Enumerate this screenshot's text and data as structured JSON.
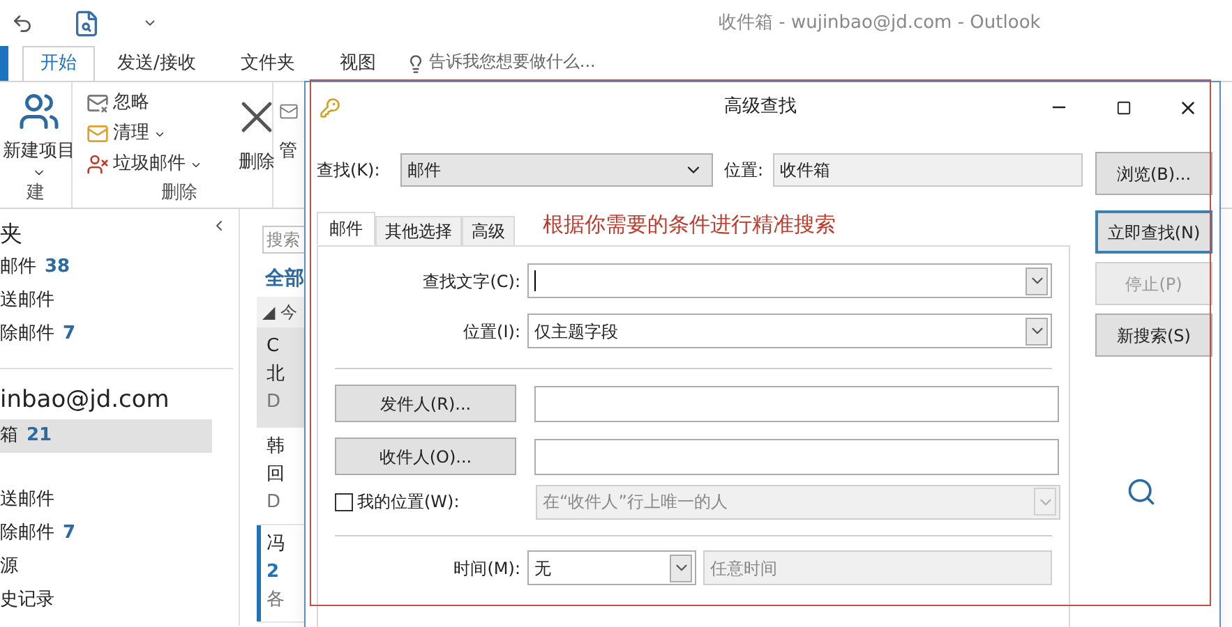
{
  "app": {
    "title": "收件箱 - wujinbao@jd.com - Outlook"
  },
  "ribbon": {
    "tabs": [
      {
        "label": "开始",
        "selected": true
      },
      {
        "label": "发送/接收",
        "selected": false
      },
      {
        "label": "文件夹",
        "selected": false
      },
      {
        "label": "视图",
        "selected": false
      }
    ],
    "tell_me": "告诉我您想要做什么...",
    "groups": [
      {
        "label": "建",
        "buttons": [
          {
            "kind": "large",
            "label": "新建项目",
            "dropdown": true
          }
        ]
      },
      {
        "label": "删除",
        "buttons": [
          {
            "kind": "small",
            "label": "忽略",
            "dropdown": false
          },
          {
            "kind": "small",
            "label": "清理",
            "dropdown": true
          },
          {
            "kind": "small",
            "label": "垃圾邮件",
            "dropdown": true
          },
          {
            "kind": "large",
            "label": "删除",
            "dropdown": false
          }
        ]
      },
      {
        "buttons": [
          {
            "kind": "large",
            "label": "管",
            "dropdown": false
          }
        ]
      }
    ]
  },
  "folder_pane": {
    "header": "夹",
    "favorites": [
      {
        "name": "邮件",
        "count": "38"
      },
      {
        "name": "送邮件"
      },
      {
        "name": "除邮件",
        "count": "7"
      }
    ],
    "account": "inbao@jd.com",
    "folders": [
      {
        "name": "箱",
        "count": "21",
        "selected": true
      },
      {
        "name": "送邮件",
        "selected": false
      },
      {
        "name": "除邮件",
        "count": "7",
        "selected": false
      },
      {
        "name": "源",
        "selected": false
      },
      {
        "name": "史记录",
        "selected": false
      }
    ]
  },
  "message_list": {
    "search_placeholder": "搜索",
    "filter": "全部",
    "group": "◢ 今",
    "messages": [
      {
        "lines": [
          "C",
          "北",
          "D"
        ],
        "selected": true,
        "unread": false
      },
      {
        "lines": [
          "韩",
          "回",
          "D"
        ],
        "selected": false,
        "unread": false
      },
      {
        "lines": [
          "冯",
          "2",
          "各"
        ],
        "selected": false,
        "unread": true
      }
    ]
  },
  "dialog": {
    "title": "高级查找",
    "look_for": {
      "label": "查找(K):",
      "value": "邮件"
    },
    "in": {
      "label": "位置:",
      "value": "收件箱"
    },
    "browse": "浏览(B)...",
    "tabs": [
      {
        "label": "邮件",
        "selected": true
      },
      {
        "label": "其他选择",
        "selected": false
      },
      {
        "label": "高级",
        "selected": false
      }
    ],
    "actions": [
      {
        "label": "立即查找(N)",
        "default": true,
        "disabled": false
      },
      {
        "label": "停止(P)",
        "default": false,
        "disabled": true
      },
      {
        "label": "新搜索(S)",
        "default": false,
        "disabled": false
      }
    ],
    "search_text": {
      "label": "查找文字(C):",
      "focused": true
    },
    "in_field": {
      "label": "位置(I):",
      "value": "仅主题字段"
    },
    "from": {
      "button": "发件人(R)..."
    },
    "sent_to": {
      "button": "收件人(O)..."
    },
    "where_i_am": {
      "label": "我的位置(W):",
      "checked": false,
      "value": "在“收件人”行上唯一的人",
      "disabled": true
    },
    "time": {
      "label": "时间(M):",
      "value": "无",
      "range": "任意时间",
      "range_disabled": true
    }
  },
  "annotation": "根据你需要的条件进行精准搜索"
}
